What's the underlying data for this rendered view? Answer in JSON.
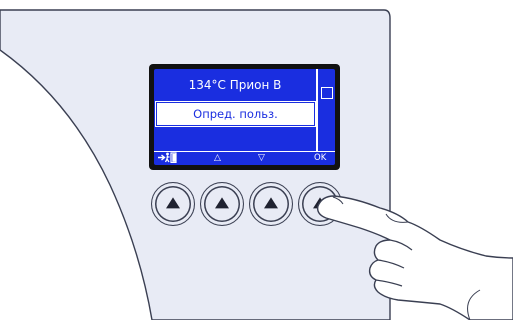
{
  "display": {
    "title": "134°C Прион B",
    "selected_item": "Опред. польз.",
    "softkeys": {
      "exit": "exit-icon",
      "up": "△",
      "down": "▽",
      "ok": "OK"
    },
    "scrollbar_icon": "scroll-position-icon"
  },
  "buttons": [
    {
      "icon": "up-arrow-icon"
    },
    {
      "icon": "up-arrow-icon"
    },
    {
      "icon": "up-arrow-icon"
    },
    {
      "icon": "up-arrow-icon",
      "pressed": true
    }
  ],
  "colors": {
    "lcd_background": "#1a2ee0",
    "lcd_text": "#ffffff",
    "panel": "#e8ebf5",
    "outline": "#3a3f52"
  }
}
